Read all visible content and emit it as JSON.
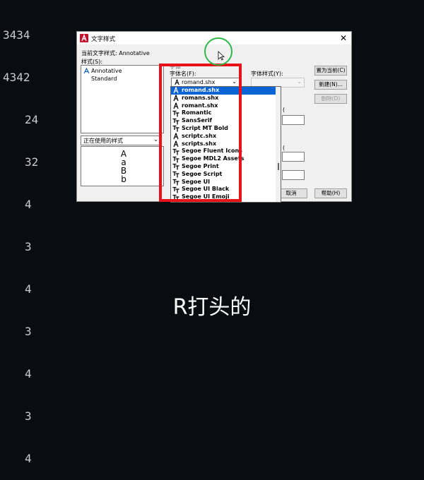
{
  "background_numbers": [
    "3434",
    "4342",
    "24",
    "32",
    "4",
    "3",
    "4",
    "3",
    "4",
    "3",
    "4"
  ],
  "dialog": {
    "title": "文字样式",
    "close_glyph": "✕",
    "current_style_label": "当前文字样式: Annotative",
    "styles_label": "样式(S):",
    "styles": [
      "Annotative",
      "Standard"
    ],
    "filter_value": "正在使用的样式",
    "font_label_partial": "字体",
    "font_name_label": "字体名(F):",
    "font_value": "romand.shx",
    "font_style_label": "字体样式(Y):",
    "set_current_button": "置为当前(C)",
    "new_button": "新建(N)...",
    "delete_button": "删除(D)",
    "cancel_button": "取消",
    "help_button": "帮助(H)",
    "preview_text": "AaBb"
  },
  "font_list": [
    {
      "name": "romand.shx",
      "icon": "shx-compass-icon"
    },
    {
      "name": "romans.shx",
      "icon": "shx-compass-icon"
    },
    {
      "name": "romant.shx",
      "icon": "shx-compass-icon"
    },
    {
      "name": "Romantic",
      "icon": "truetype-icon"
    },
    {
      "name": "SansSerif",
      "icon": "truetype-icon"
    },
    {
      "name": "Script MT Bold",
      "icon": "truetype-icon"
    },
    {
      "name": "scriptc.shx",
      "icon": "shx-compass-icon"
    },
    {
      "name": "scripts.shx",
      "icon": "shx-compass-icon"
    },
    {
      "name": "Segoe Fluent Icons",
      "icon": "truetype-icon"
    },
    {
      "name": "Segoe MDL2 Assets",
      "icon": "truetype-icon"
    },
    {
      "name": "Segoe Print",
      "icon": "truetype-icon"
    },
    {
      "name": "Segoe Script",
      "icon": "truetype-icon"
    },
    {
      "name": "Segoe UI",
      "icon": "truetype-icon"
    },
    {
      "name": "Segoe UI Black",
      "icon": "truetype-icon"
    },
    {
      "name": "Segoe UI Emoji",
      "icon": "truetype-icon"
    }
  ],
  "selected_font_index": 0,
  "subtitle": "R打头的",
  "colors": {
    "highlight": "#e8121a",
    "cursor_circle": "#2fb84a",
    "selection": "#0a64d6",
    "app_icon": "#c8102e"
  }
}
